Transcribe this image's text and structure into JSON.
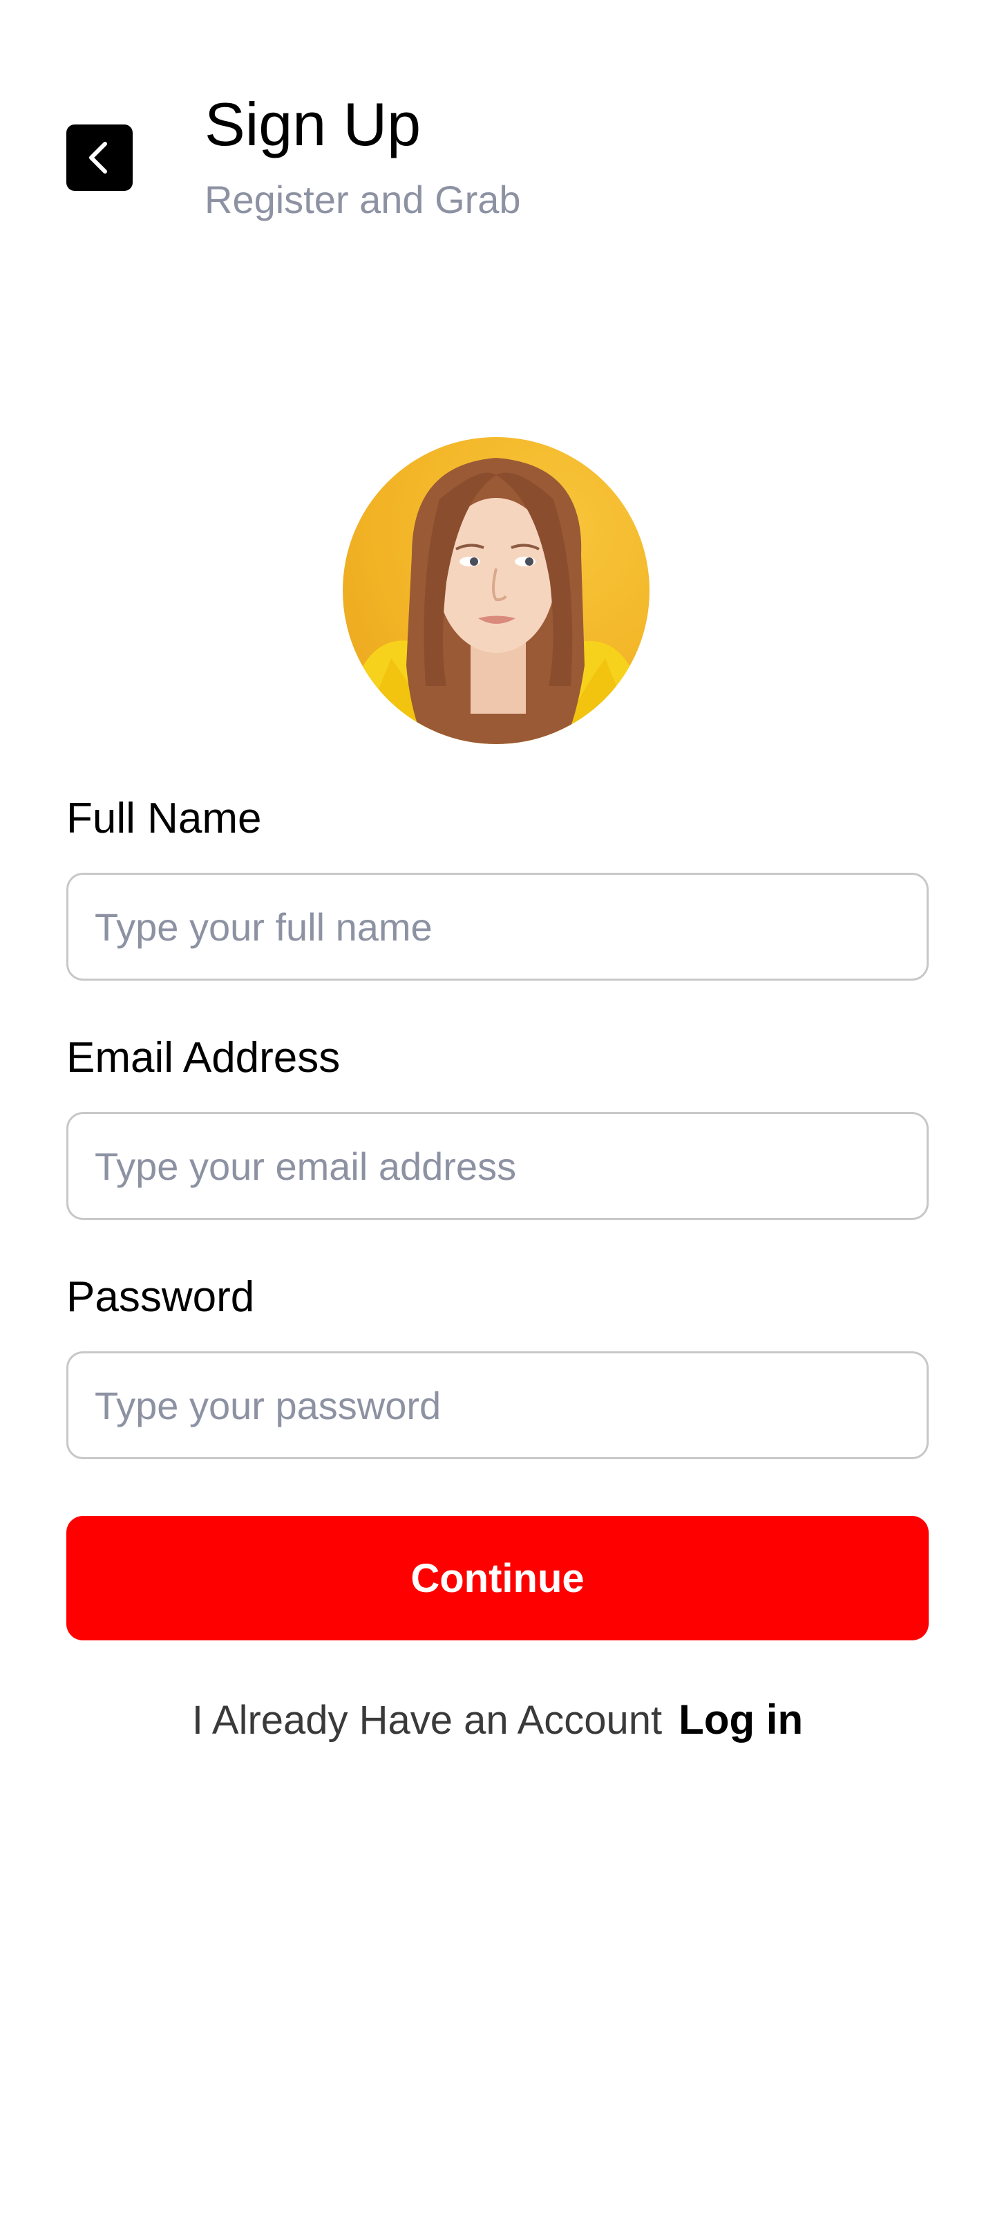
{
  "header": {
    "title": "Sign Up",
    "subtitle": "Register and Grab",
    "back_icon": "chevron-left-icon"
  },
  "avatar": {
    "icon": "profile-photo"
  },
  "form": {
    "full_name": {
      "label": "Full Name",
      "placeholder": "Type your full name",
      "value": ""
    },
    "email": {
      "label": "Email Address",
      "placeholder": "Type your email address",
      "value": ""
    },
    "password": {
      "label": "Password",
      "placeholder": "Type your password",
      "value": ""
    },
    "continue_label": "Continue"
  },
  "footer": {
    "prompt": "I Already Have an Account",
    "login_label": "Log in"
  },
  "colors": {
    "accent": "#ff0000",
    "subtitle": "#8d92a3",
    "avatar_background": "#f4b82a",
    "input_border": "#c8c8c8"
  }
}
